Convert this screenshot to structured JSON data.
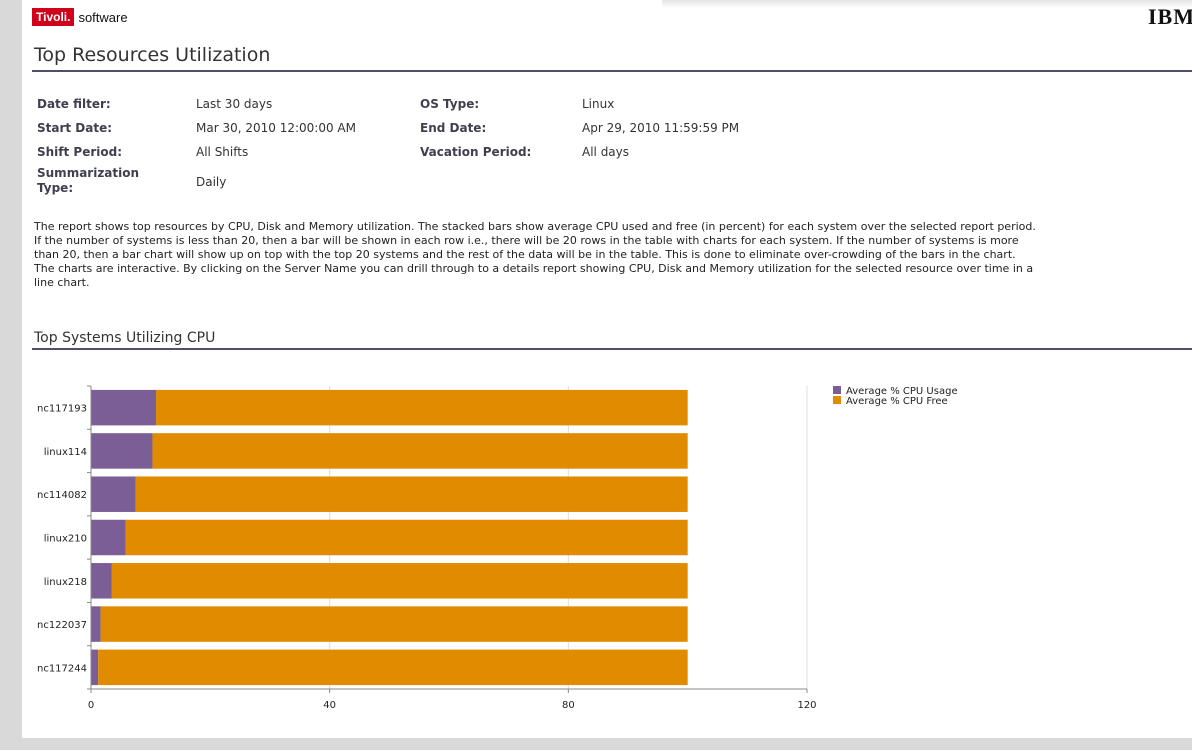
{
  "brand": {
    "badge": "Tivoli.",
    "text": "software",
    "vendor_logo": "IBM"
  },
  "report": {
    "title": "Top Resources Utilization"
  },
  "params": [
    {
      "label": "Date filter:",
      "value": "Last 30 days"
    },
    {
      "label": "Start Date:",
      "value": "Mar 30, 2010 12:00:00 AM"
    },
    {
      "label": "Shift Period:",
      "value": "All Shifts"
    },
    {
      "label": "Summarization Type:",
      "value": "Daily"
    },
    {
      "label": "OS Type:",
      "value": "Linux"
    },
    {
      "label": "End Date:",
      "value": "Apr 29, 2010 11:59:59 PM"
    },
    {
      "label": "Vacation Period:",
      "value": "All days"
    }
  ],
  "description": [
    "The report shows top resources by CPU, Disk and  Memory utilization. The stacked bars show average CPU used and free (in percent) for each system over the selected report period.",
    "If the number of systems is less than 20, then a bar will be shown in each row i.e., there will be 20 rows in the table with charts for each system. If the number of systems is more",
    "than 20, then a bar chart will show up on top with the top 20 systems and the rest of the data will be in the table. This is done to eliminate over-crowding of the bars in the chart.",
    "The charts are interactive. By clicking on the Server Name you can drill through to a details report showing CPU, Disk and Memory utilization for the selected resource over time in a",
    "line chart."
  ],
  "section": {
    "title": "Top Systems Utilizing CPU"
  },
  "colors": {
    "usage": "#7b5e96",
    "free": "#e08b00",
    "rule": "#4d4f6b",
    "brand_red": "#d0021b"
  },
  "chart_data": {
    "type": "bar",
    "orientation": "horizontal",
    "stacked": true,
    "categories": [
      "nc117193",
      "linux114",
      "nc114082",
      "linux210",
      "linux218",
      "nc122037",
      "nc117244"
    ],
    "series": [
      {
        "name": "Average % CPU Usage",
        "values": [
          10.9,
          10.3,
          7.5,
          5.8,
          3.5,
          1.6,
          1.2
        ]
      },
      {
        "name": "Average % CPU Free",
        "values": [
          89.1,
          89.7,
          92.5,
          94.2,
          96.5,
          98.4,
          98.8
        ]
      }
    ],
    "xticks": [
      0,
      40,
      80,
      120
    ],
    "xlim": [
      0,
      120
    ],
    "grid": true,
    "legend": "top-right"
  }
}
